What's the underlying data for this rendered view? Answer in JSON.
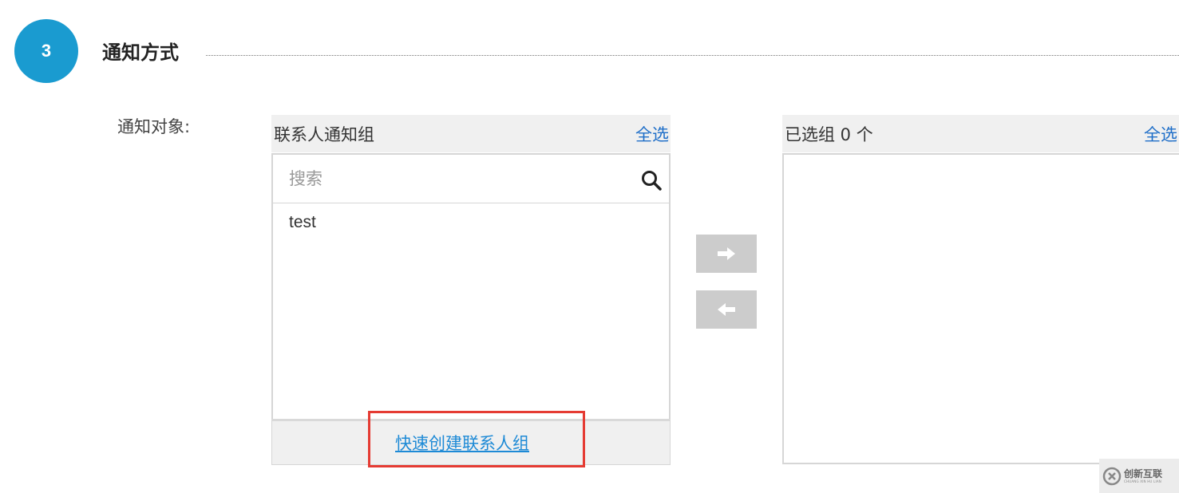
{
  "step": {
    "number": "3",
    "title": "通知方式"
  },
  "field": {
    "label": "通知对象:"
  },
  "left_panel": {
    "title": "联系人通知组",
    "select_all": "全选",
    "search": {
      "placeholder": "搜索",
      "value": ""
    },
    "items": [
      {
        "label": "test"
      }
    ],
    "footer_link": "快速创建联系人组"
  },
  "transfer": {
    "add_icon": "arrow-right-icon",
    "remove_icon": "arrow-left-icon"
  },
  "right_panel": {
    "title": "已选组 0 个",
    "select_all": "全选",
    "items": []
  },
  "watermark": {
    "name": "创新互联",
    "sub": "CHUANG XIN HU LIAN"
  },
  "colors": {
    "accent": "#1a9bd0",
    "link": "#1e6ec8",
    "highlight": "#e53b33",
    "button": "#cccccc"
  }
}
